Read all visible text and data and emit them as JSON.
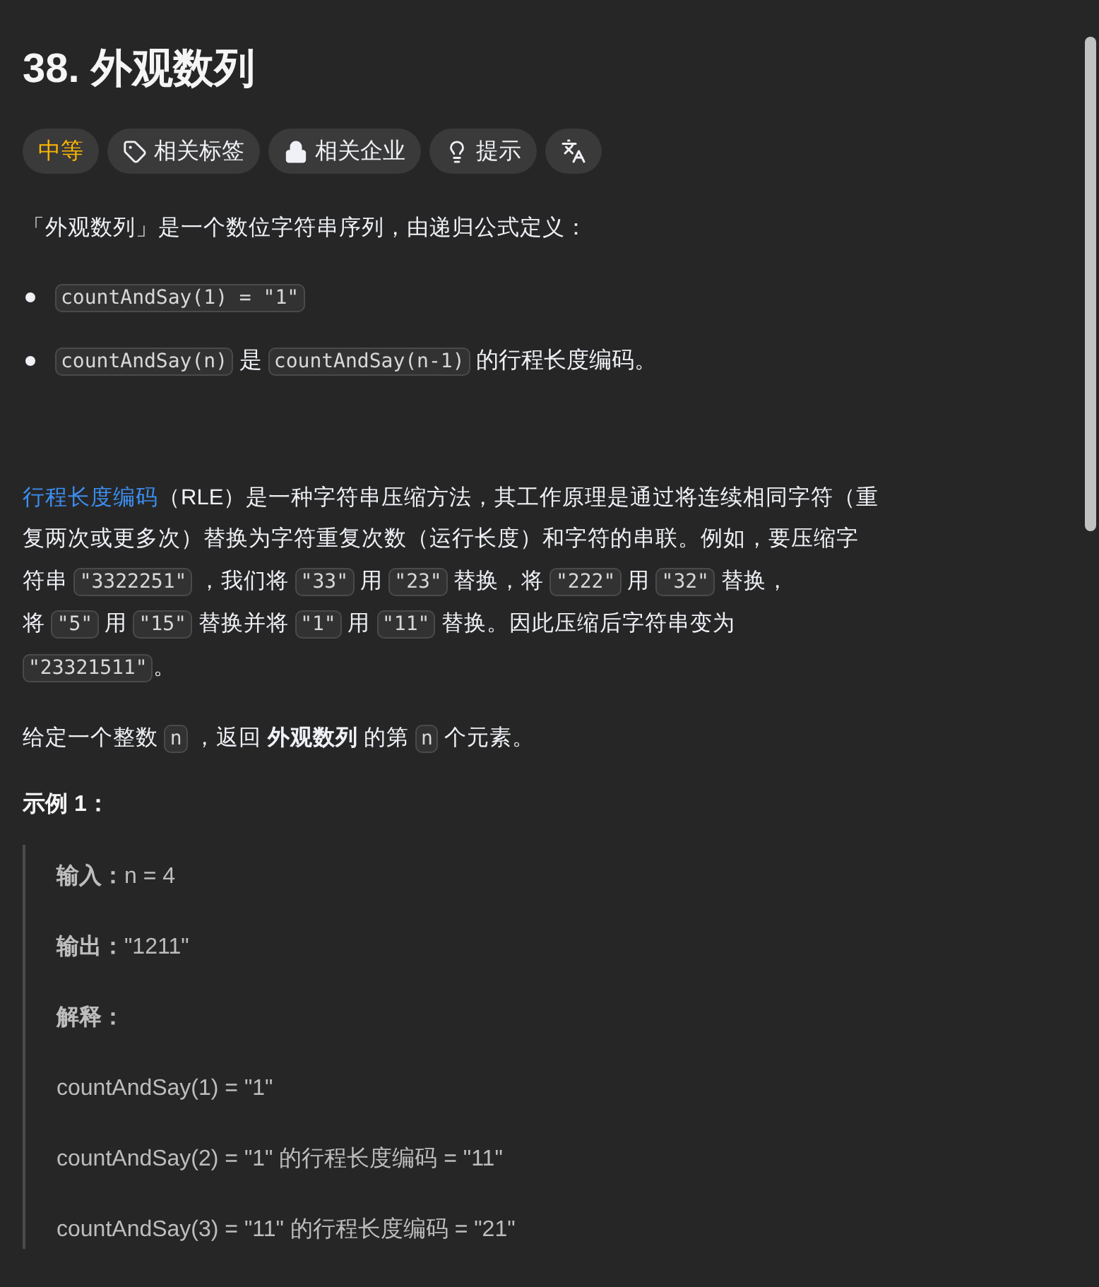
{
  "title": "38. 外观数列",
  "tags": [
    {
      "kind": "difficulty",
      "label": "中等"
    },
    {
      "kind": "tag",
      "label": "相关标签"
    },
    {
      "kind": "lock",
      "label": "相关企业"
    },
    {
      "kind": "hint",
      "label": "提示"
    },
    {
      "kind": "translate"
    }
  ],
  "intro": [
    {
      "kind": "text",
      "text": "「外观数列」是一个数位字符串序列，由递归公式定义："
    }
  ],
  "bullets": [
    [
      {
        "kind": "code",
        "text": "countAndSay(1) = \"1\""
      }
    ],
    [
      {
        "kind": "code",
        "text": "countAndSay(n)"
      },
      {
        "kind": "text",
        "text": " 是 "
      },
      {
        "kind": "code",
        "text": "countAndSay(n-1)"
      },
      {
        "kind": "text",
        "text": " 的行程长度编码。"
      }
    ]
  ],
  "paragraphs": [
    [
      {
        "kind": "link",
        "text": "行程长度编码"
      },
      {
        "kind": "text",
        "text": "（RLE）是一种字符串压缩方法，其工作原理是通过将连续相同字符（重"
      },
      {
        "kind": "break"
      },
      {
        "kind": "text",
        "text": "复两次或更多次）替换为字符重复次数（运行长度）和字符的串联。例如，要压缩字"
      },
      {
        "kind": "break"
      },
      {
        "kind": "text",
        "text": "符串 "
      },
      {
        "kind": "code",
        "text": "\"3322251\""
      },
      {
        "kind": "text",
        "text": " ，我们将 "
      },
      {
        "kind": "code",
        "text": "\"33\""
      },
      {
        "kind": "text",
        "text": " 用 "
      },
      {
        "kind": "code",
        "text": "\"23\""
      },
      {
        "kind": "text",
        "text": " 替换，将 "
      },
      {
        "kind": "code",
        "text": "\"222\""
      },
      {
        "kind": "text",
        "text": " 用 "
      },
      {
        "kind": "code",
        "text": "\"32\""
      },
      {
        "kind": "text",
        "text": " 替换，"
      },
      {
        "kind": "break"
      },
      {
        "kind": "text",
        "text": "将 "
      },
      {
        "kind": "code",
        "text": "\"5\""
      },
      {
        "kind": "text",
        "text": " 用 "
      },
      {
        "kind": "code",
        "text": "\"15\""
      },
      {
        "kind": "text",
        "text": " 替换并将 "
      },
      {
        "kind": "code",
        "text": "\"1\""
      },
      {
        "kind": "text",
        "text": " 用 "
      },
      {
        "kind": "code",
        "text": "\"11\""
      },
      {
        "kind": "text",
        "text": " 替换。因此压缩后字符串变为"
      },
      {
        "kind": "break"
      },
      {
        "kind": "code",
        "text": "\"23321511\""
      },
      {
        "kind": "text",
        "text": "。"
      }
    ],
    [
      {
        "kind": "text",
        "text": "给定一个整数 "
      },
      {
        "kind": "code",
        "text": "n"
      },
      {
        "kind": "text",
        "text": " ，返回 **外观数列** 的第 "
      },
      {
        "kind": "code",
        "text": "n"
      },
      {
        "kind": "text",
        "text": " 个元素。"
      }
    ]
  ],
  "example": {
    "heading": "示例 1：",
    "lines": [
      "**输入：**n = 4",
      "**输出：**\"1211\"",
      "**解释：**",
      "countAndSay(1) = \"1\"",
      "countAndSay(2) = \"1\" 的行程长度编码 = \"11\"",
      "countAndSay(3) = \"11\" 的行程长度编码 = \"21\""
    ]
  }
}
